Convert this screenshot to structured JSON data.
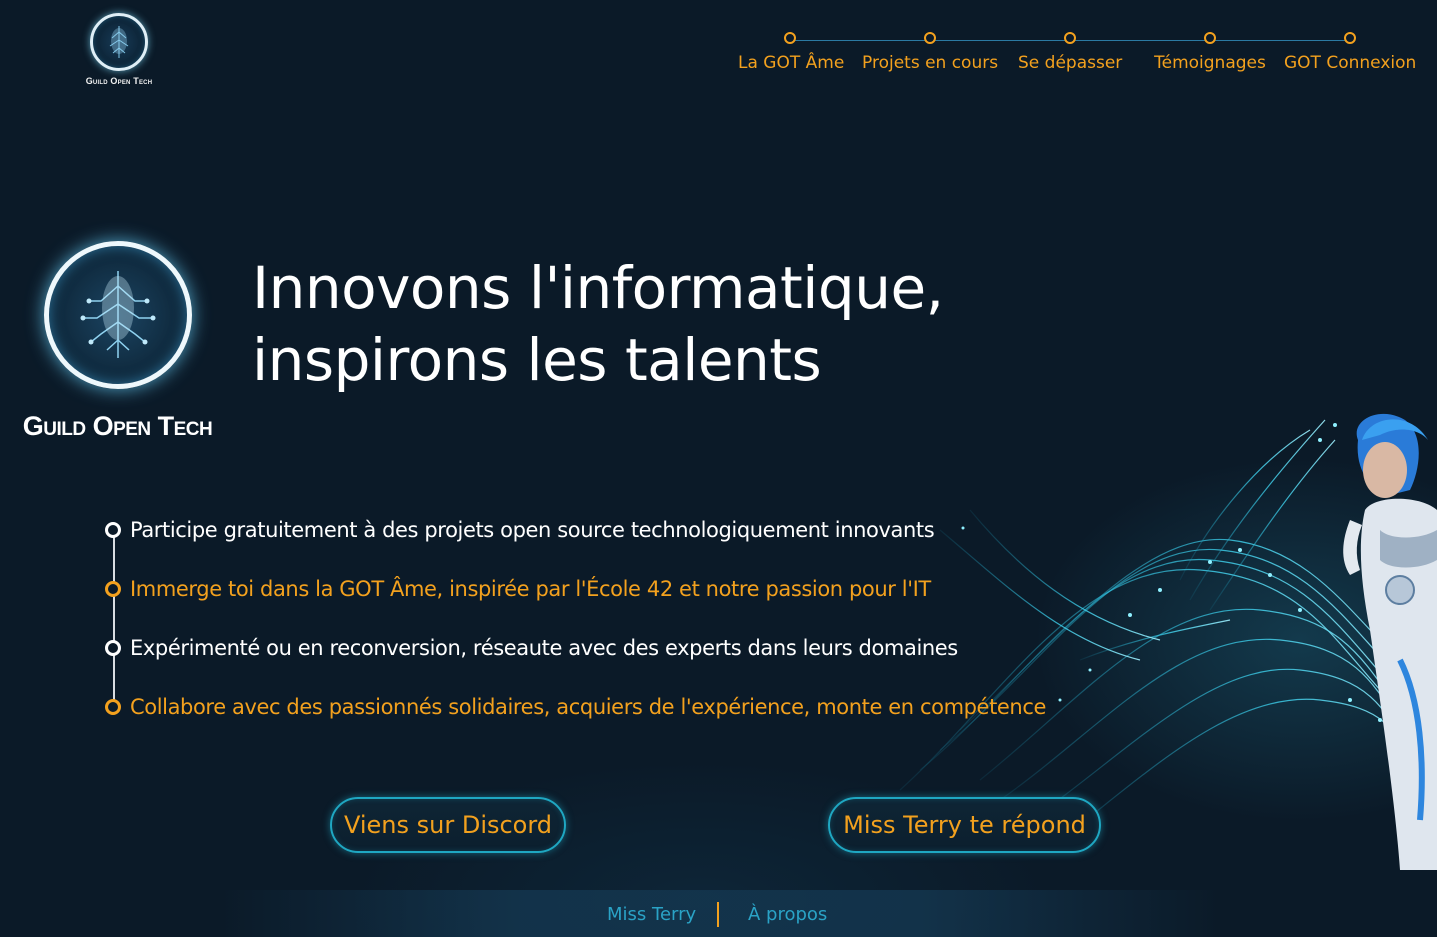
{
  "brand": {
    "name_small": "Guild Open Tech",
    "name_large": "Guild Open Tech"
  },
  "nav": {
    "items": [
      {
        "label": "La GOT Âme"
      },
      {
        "label": "Projets en cours"
      },
      {
        "label": "Se dépasser"
      },
      {
        "label": "Témoignages"
      },
      {
        "label": "GOT Connexion"
      }
    ]
  },
  "hero": {
    "title_line1": "Innovons l'informatique,",
    "title_line2": "inspirons les talents"
  },
  "features": [
    {
      "text": "Participe gratuitement à des projets open source technologiquement innovants",
      "color": "#ffffff"
    },
    {
      "text": "Immerge toi dans la GOT Âme, inspirée par l'École 42 et notre passion pour l'IT",
      "color": "#f3a11e"
    },
    {
      "text": "Expérimenté ou en reconversion, réseaute avec des experts dans leurs domaines",
      "color": "#ffffff"
    },
    {
      "text": "Collabore avec des passionnés solidaires, acquiers de l'expérience, monte en compétence",
      "color": "#f3a11e"
    }
  ],
  "buttons": {
    "discord": "Viens sur Discord",
    "terry": "Miss Terry te répond"
  },
  "footer": {
    "link1": "Miss Terry",
    "link2": "À propos"
  },
  "colors": {
    "background": "#0b1a28",
    "accent": "#f3a11e",
    "cyan": "#1fa7c2",
    "text": "#ffffff"
  },
  "icons": {
    "logo": "circuit-tree-icon",
    "nav_marker": "circle-node-icon",
    "feature_marker": "circle-node-icon"
  }
}
